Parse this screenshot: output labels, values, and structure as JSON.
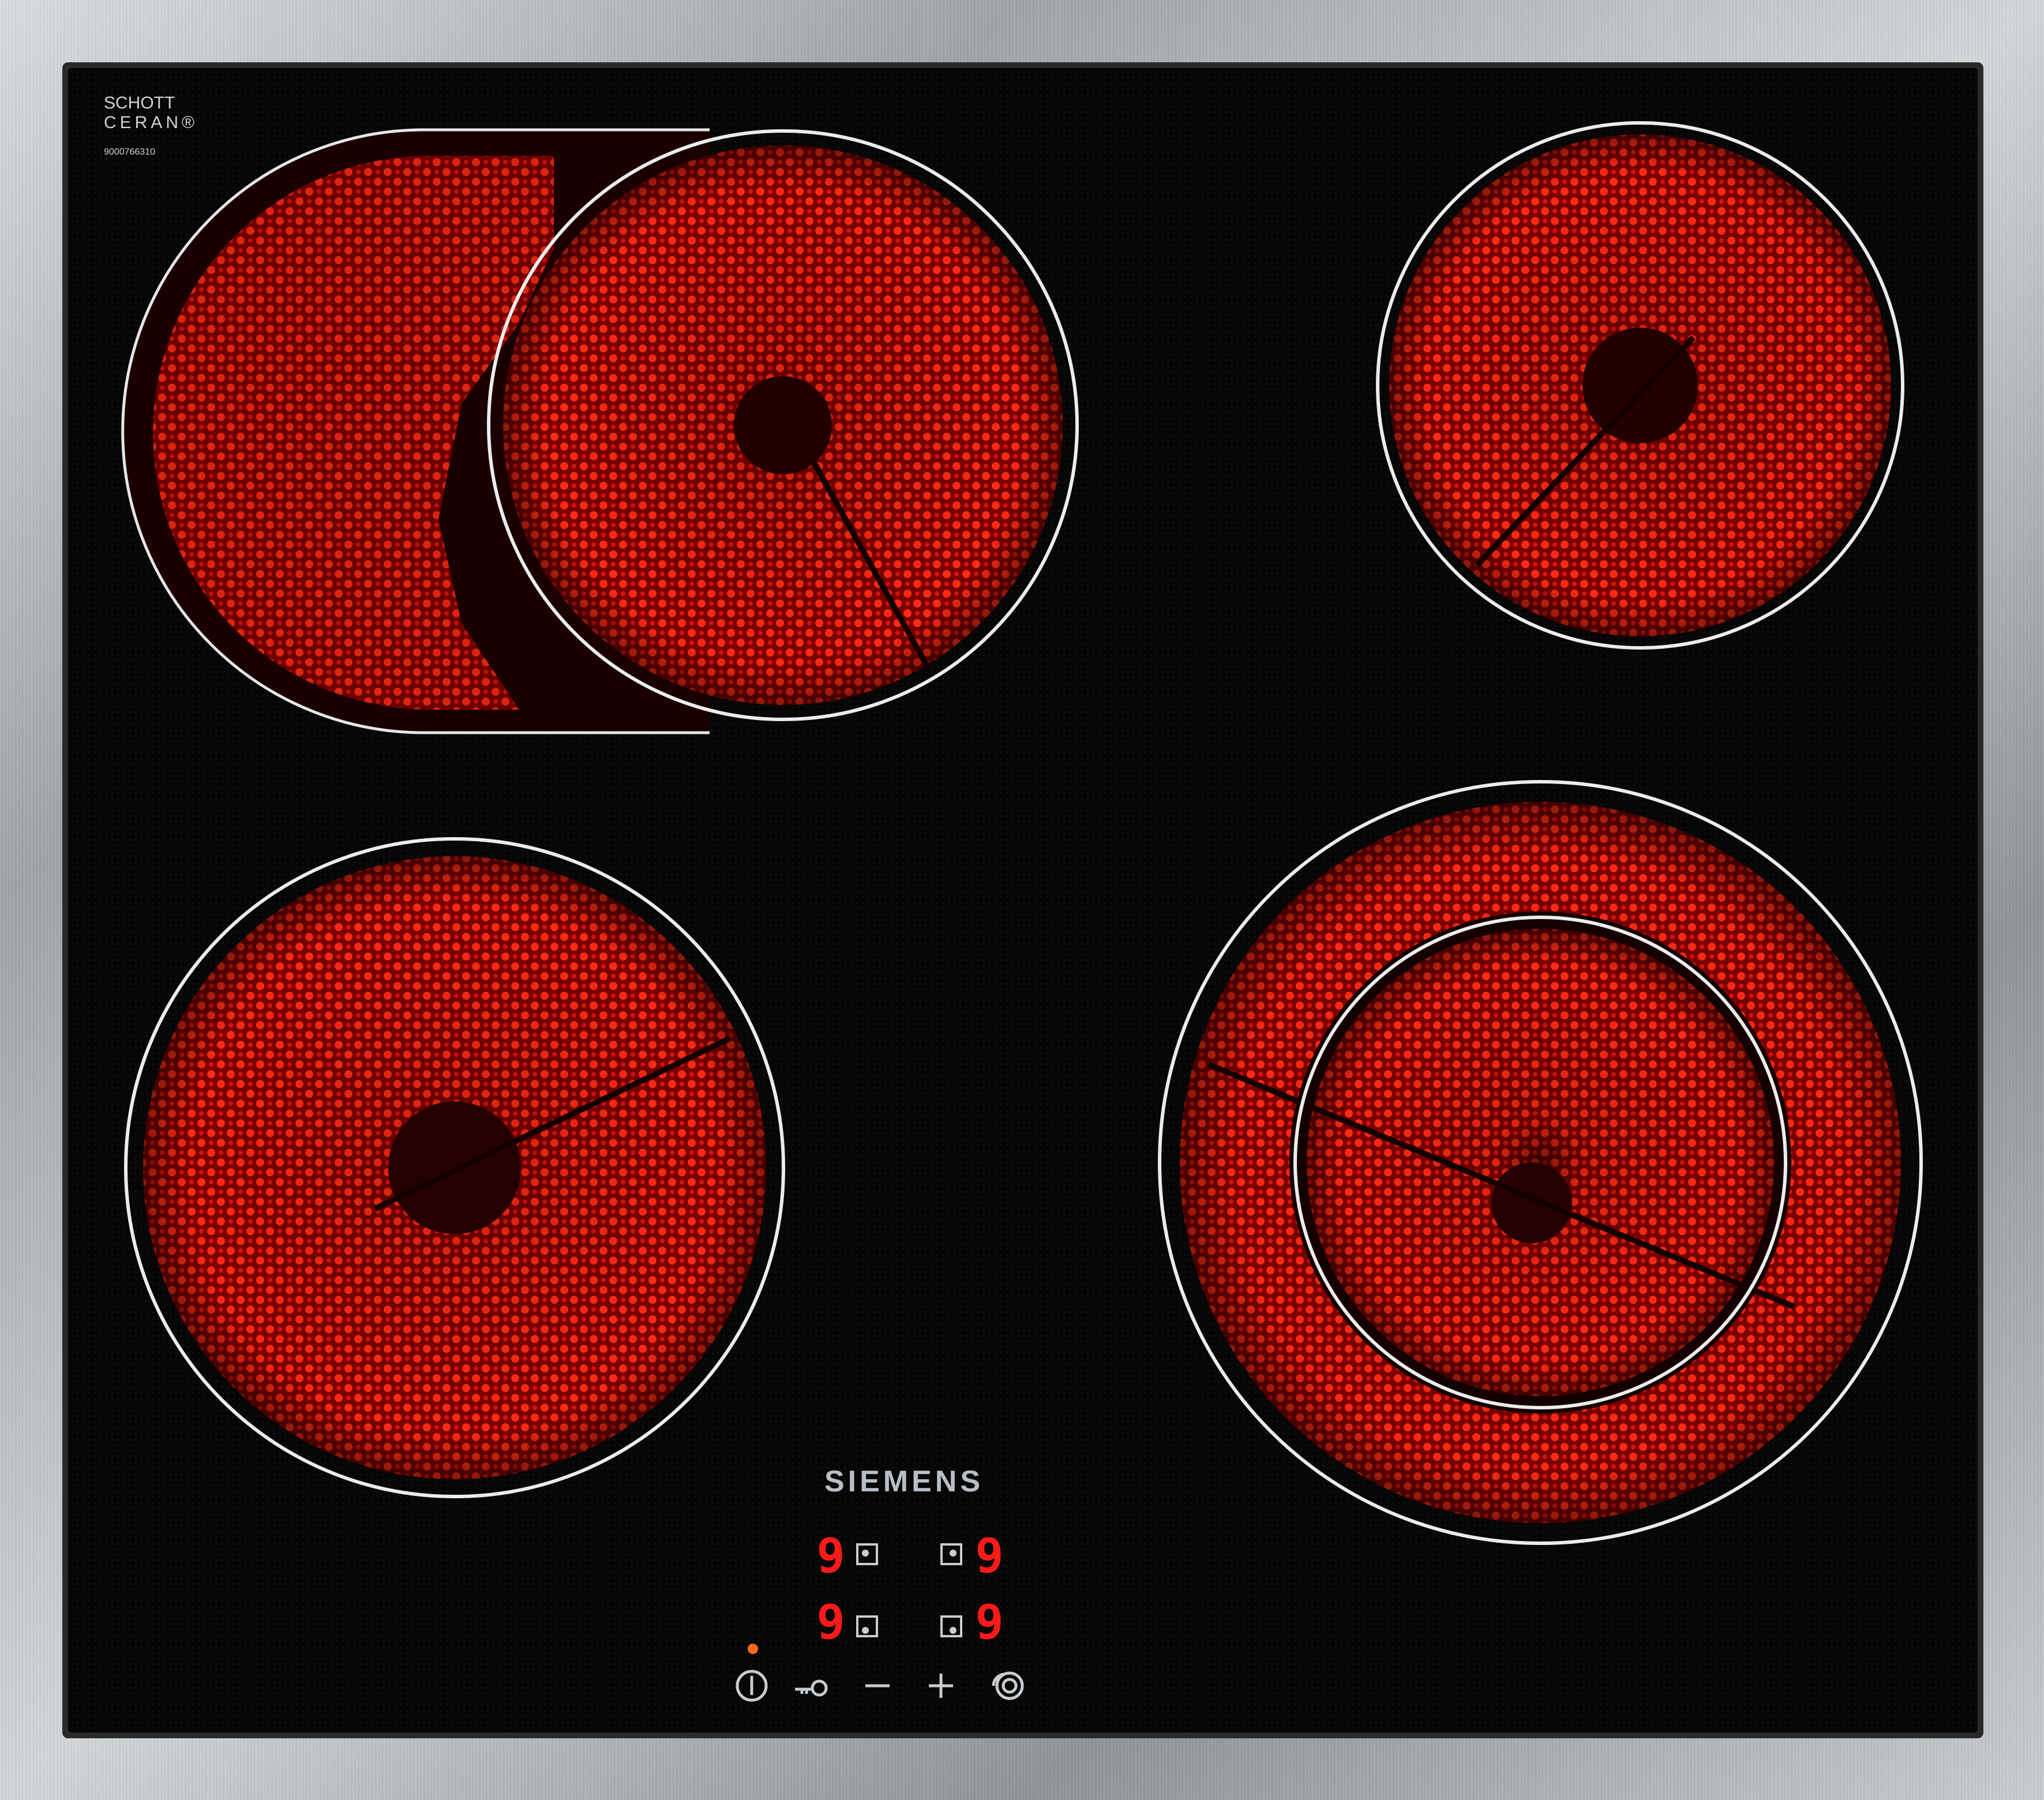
{
  "cooktop": {
    "brand": "SIEMENS",
    "glass_maker_line1": "SCHOTT",
    "glass_maker_line2": "CERAN®",
    "serial": "9000766310",
    "colors": {
      "frame": "#b9bcbf",
      "glass": "#050505",
      "glow": "#ff1a10",
      "outline": "#e6e6e6",
      "display": "#ff1a1a"
    },
    "zones": [
      {
        "name": "front-left",
        "state": "on"
      },
      {
        "name": "back-left-oval",
        "state": "on"
      },
      {
        "name": "back-right",
        "state": "on"
      },
      {
        "name": "front-right-dual",
        "state": "on"
      }
    ],
    "displays": {
      "top_left": "9",
      "top_right": "9",
      "bottom_left": "9",
      "bottom_right": "9"
    },
    "controls": [
      {
        "name": "power",
        "icon": "power-icon"
      },
      {
        "name": "child-lock",
        "icon": "key-icon"
      },
      {
        "name": "minus",
        "icon": "minus-icon"
      },
      {
        "name": "plus",
        "icon": "plus-icon"
      },
      {
        "name": "dual-zone",
        "icon": "dual-zone-icon"
      }
    ]
  }
}
